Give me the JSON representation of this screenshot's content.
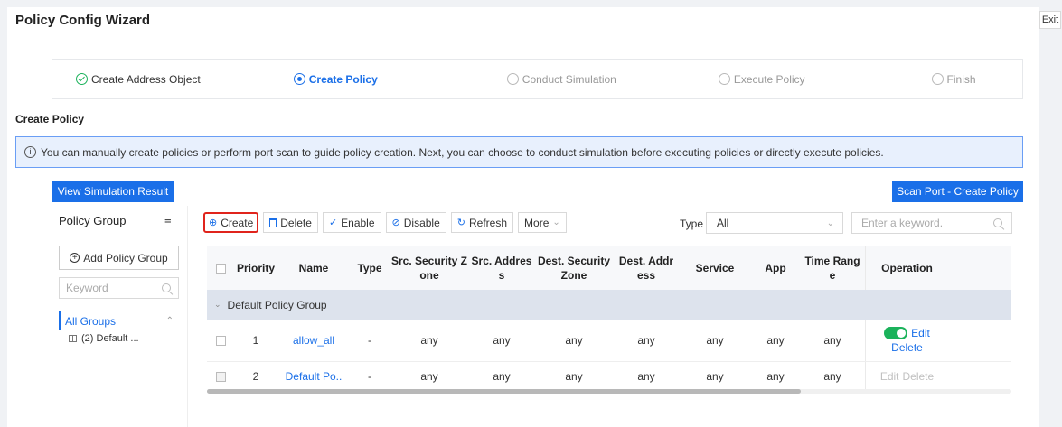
{
  "page": {
    "title": "Policy Config Wizard",
    "exit_label": "Exit"
  },
  "steps": [
    {
      "label": "Create Address Object",
      "state": "done"
    },
    {
      "label": "Create Policy",
      "state": "active"
    },
    {
      "label": "Conduct Simulation",
      "state": "pending"
    },
    {
      "label": "Execute Policy",
      "state": "pending"
    },
    {
      "label": "Finish",
      "state": "pending"
    }
  ],
  "section": {
    "title": "Create Policy",
    "info": "You can manually create policies or perform port scan to guide policy creation. Next, you can choose to conduct simulation before executing policies or directly execute policies."
  },
  "buttons": {
    "view_simulation": "View Simulation Result",
    "scan_port": "Scan Port - Create Policy"
  },
  "sidebar": {
    "title": "Policy Group",
    "add_group": "Add Policy Group",
    "keyword_placeholder": "Keyword",
    "all_groups": "All Groups",
    "group_item": "(2) Default ..."
  },
  "toolbar": {
    "create": "Create",
    "delete": "Delete",
    "enable": "Enable",
    "disable": "Disable",
    "refresh": "Refresh",
    "more": "More",
    "type_label": "Type",
    "type_value": "All",
    "search_placeholder": "Enter a keyword."
  },
  "table": {
    "headers": {
      "priority": "Priority",
      "name": "Name",
      "type": "Type",
      "src_zone_1": "Src. Security Z",
      "src_zone_2": "one",
      "src_addr_1": "Src. Addres",
      "src_addr_2": "s",
      "dest_zone_1": "Dest. Security",
      "dest_zone_2": "Zone",
      "dest_addr_1": "Dest. Addr",
      "dest_addr_2": "ess",
      "service": "Service",
      "app": "App",
      "time_range_1": "Time Rang",
      "time_range_2": "e",
      "operation": "Operation"
    },
    "group_name": "Default Policy Group",
    "rows": [
      {
        "priority": "1",
        "name": "allow_all",
        "type": "-",
        "src_zone": "any",
        "src_addr": "any",
        "dest_zone": "any",
        "dest_addr": "any",
        "service": "any",
        "app": "any",
        "time_range": "any",
        "edit": "Edit",
        "delete": "Delete",
        "enabled": true
      },
      {
        "priority": "2",
        "name": "Default Po..",
        "type": "-",
        "src_zone": "any",
        "src_addr": "any",
        "dest_zone": "any",
        "dest_addr": "any",
        "service": "any",
        "app": "any",
        "time_range": "any",
        "edit": "Edit",
        "delete": "Delete",
        "enabled": false
      }
    ]
  },
  "colors": {
    "primary": "#1a6fe8",
    "success": "#1bb25b",
    "highlight": "#e0241c"
  }
}
